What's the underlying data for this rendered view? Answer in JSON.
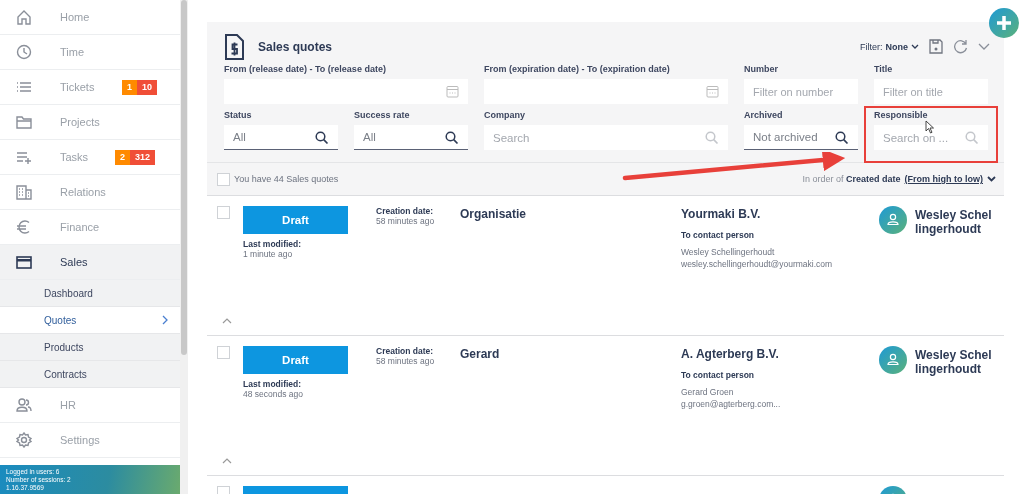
{
  "sidebar": {
    "items": [
      {
        "label": "Home",
        "selected": false
      },
      {
        "label": "Time",
        "selected": false
      },
      {
        "label": "Tickets",
        "selected": false,
        "badges": [
          {
            "value": "1",
            "color": "#ff8a00"
          },
          {
            "value": "10",
            "color": "#f04e37"
          }
        ]
      },
      {
        "label": "Projects",
        "selected": false
      },
      {
        "label": "Tasks",
        "selected": false,
        "badges": [
          {
            "value": "2",
            "color": "#ff8a00"
          },
          {
            "value": "312",
            "color": "#f04e37"
          }
        ]
      },
      {
        "label": "Relations",
        "selected": false
      },
      {
        "label": "Finance",
        "selected": false
      },
      {
        "label": "Sales",
        "selected": true,
        "expanded": true,
        "children": [
          {
            "label": "Dashboard",
            "selected": false
          },
          {
            "label": "Quotes",
            "selected": true
          },
          {
            "label": "Products",
            "selected": false
          },
          {
            "label": "Contracts",
            "selected": false
          }
        ]
      },
      {
        "label": "HR",
        "selected": false
      },
      {
        "label": "Settings",
        "selected": false
      }
    ],
    "footer": [
      "Logged in users: 6",
      "Number of sessions: 2",
      "1.16.37.9569"
    ]
  },
  "panel": {
    "title": "Sales quotes",
    "filter_label": "Filter:",
    "filter_value": "None",
    "filters": [
      {
        "kind": "date",
        "label": "From (release date) - To (release date)"
      },
      {
        "kind": "date",
        "label": "From (expiration date) - To (expiration date)"
      },
      {
        "kind": "text",
        "label": "Number",
        "placeholder": "Filter on number"
      },
      {
        "kind": "text",
        "label": "Title",
        "placeholder": "Filter on title"
      },
      {
        "kind": "select",
        "label": "Status",
        "value": "All"
      },
      {
        "kind": "select",
        "label": "Success rate",
        "value": "All"
      },
      {
        "kind": "search",
        "label": "Company",
        "placeholder": "Search"
      },
      {
        "kind": "select",
        "label": "Archived",
        "value": "Not archived"
      },
      {
        "kind": "search",
        "label": "Responsible",
        "placeholder": "Search on ..."
      }
    ],
    "count": {
      "checked": false,
      "text": "You have 44 Sales quotes"
    },
    "sort": {
      "text": "In order of **Created date**",
      "link": "(From high to low)"
    }
  },
  "quotes": [
    {
      "checked": false,
      "status": "Draft",
      "modified_label": "Last modified:",
      "modified": "1 minute ago",
      "created_label": "Creation date:",
      "created": "58 minutes ago",
      "title": "Organisatie",
      "company": "Yourmaki B.V.",
      "contact_label": "To contact person",
      "contact_name": "Wesley Schellingerhoudt",
      "contact_email": "wesley.schellingerhoudt@yourmaki.com",
      "responsible": "Wesley Schellingerhoudt"
    },
    {
      "checked": false,
      "status": "Draft",
      "modified_label": "Last modified:",
      "modified": "48 seconds ago",
      "created_label": "Creation date:",
      "created": "58 minutes ago",
      "title": "Gerard",
      "company": "A. Agterberg B.V.",
      "contact_label": "To contact person",
      "contact_name": "Gerard Groen",
      "contact_email": "g.groen@agterberg.com...",
      "responsible": "Wesley Schellingerhoudt"
    },
    {
      "checked": false
    }
  ]
}
